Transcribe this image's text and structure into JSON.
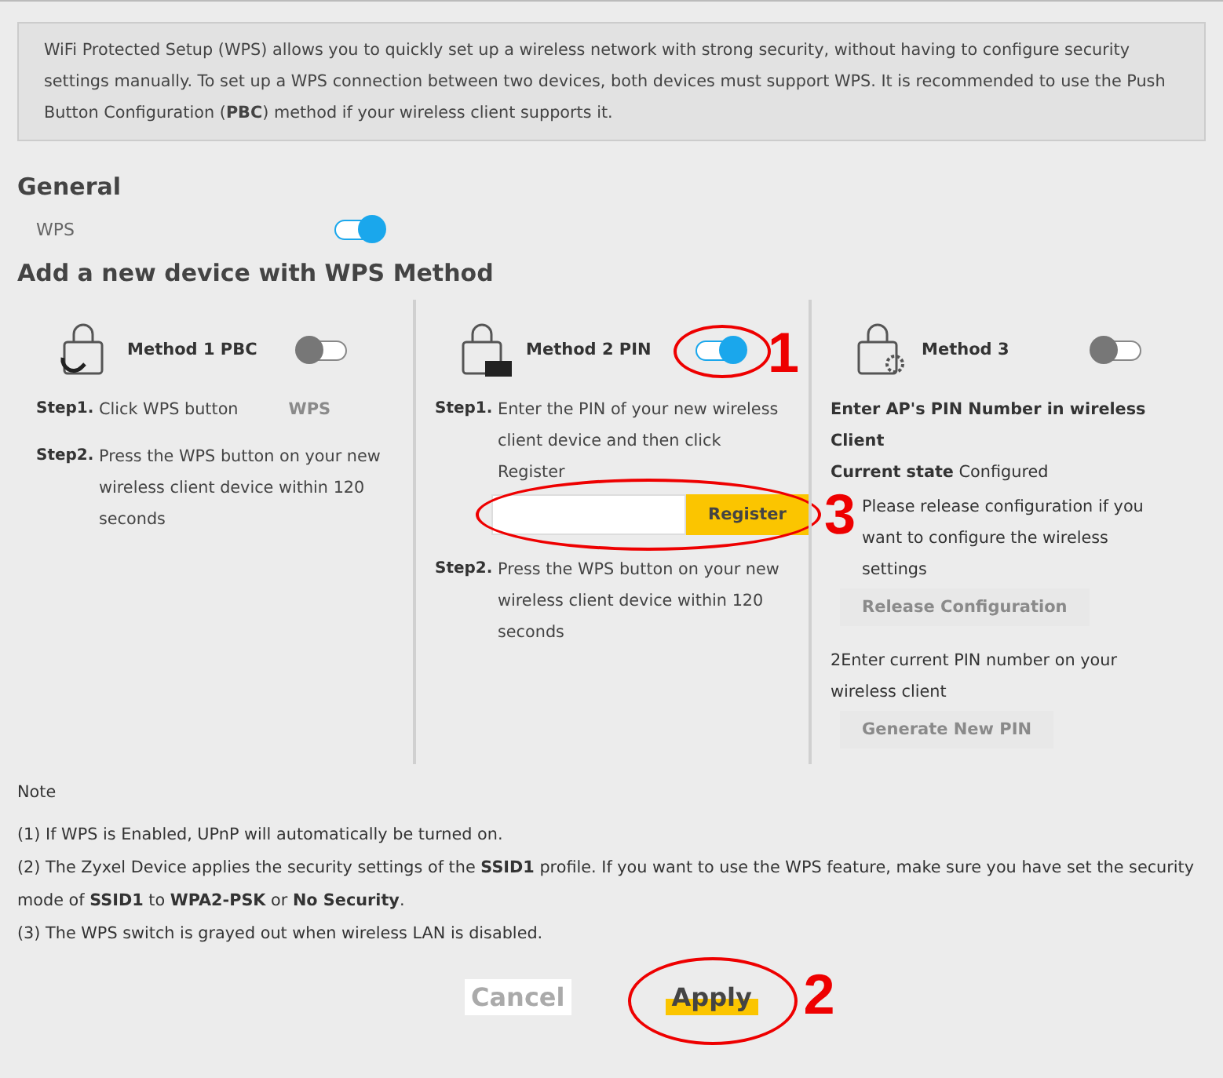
{
  "intro": "WiFi Protected Setup (WPS) allows you to quickly set up a wireless network with strong security, without having to configure security settings manually. To set up a WPS connection between two devices, both devices must support WPS. It is recommended to use the Push Button Configuration (**PBC**) method if your wireless client supports it.",
  "general": {
    "heading": "General",
    "wps_label": "WPS",
    "wps_on": true
  },
  "methods_heading": "Add a new device with WPS Method",
  "methods": [
    {
      "kind": "pbc",
      "title": "Method 1 PBC",
      "on": false,
      "steps": [
        {
          "label": "Step1.",
          "text": "Click WPS button",
          "button": {
            "label": "WPS",
            "disabled": true
          }
        },
        {
          "label": "Step2.",
          "text": "Press the WPS button on your new wireless client device within 120 seconds"
        }
      ]
    },
    {
      "kind": "pin",
      "title": "Method 2 PIN",
      "on": true,
      "steps": [
        {
          "label": "Step1.",
          "text": "Enter the PIN of your new wireless client device and then click Register",
          "button": {
            "label": "Register",
            "disabled": false
          }
        },
        {
          "label": "Step2.",
          "text": "Press the WPS button on your new wireless client device within 120 seconds"
        }
      ]
    },
    {
      "kind": "ap",
      "title": "Method 3",
      "on": false,
      "heading": "Enter AP's PIN Number in wireless Client",
      "state": "**Current state** Configured",
      "items": [
        {
          "text": "Please release configuration if you want to configure the wireless settings",
          "button": {
            "label": "Release Configuration",
            "disabled": true
          }
        },
        {
          "text": "2Enter current PIN number on your wireless client",
          "button": {
            "label": "Generate New PIN",
            "disabled": true
          }
        }
      ]
    }
  ],
  "note": {
    "title": "Note",
    "items": [
      "(1) If WPS is Enabled, UPnP will automatically be turned on.",
      "(2) The Zyxel Device applies the security settings of the **SSID1** profile. If you want to use the WPS feature, make sure you have set the security mode of **SSID1** to **WPA2-PSK** or **No Security**.",
      "(3) The WPS switch is grayed out when wireless LAN is disabled."
    ]
  },
  "buttons": [
    {
      "label": "Cancel",
      "kind": "cancel"
    },
    {
      "label": "Apply",
      "kind": "apply"
    }
  ],
  "callouts": [
    "1",
    "2",
    "3"
  ]
}
